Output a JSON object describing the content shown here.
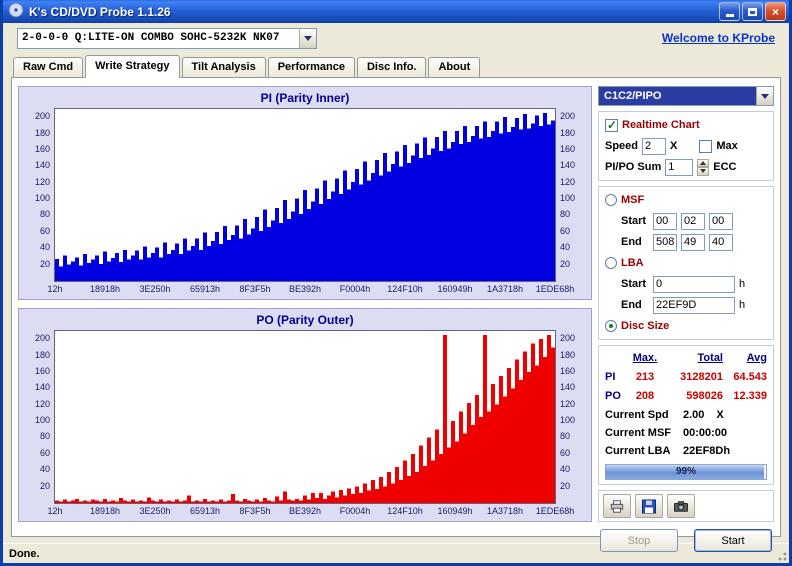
{
  "window": {
    "title": "K's CD/DVD Probe 1.1.26"
  },
  "toolbar": {
    "drive_selector": "2-0-0-0 Q:LITE-ON COMBO SOHC-5232K NK07",
    "welcome_link": "Welcome to KProbe"
  },
  "tabs": {
    "items": [
      "Raw Cmd",
      "Write Strategy",
      "Tilt Analysis",
      "Performance",
      "Disc Info.",
      "About"
    ],
    "active": "Write Strategy"
  },
  "side": {
    "mode_select": "C1C2/PIPO",
    "realtime_chart": {
      "label": "Realtime Chart",
      "checked": true
    },
    "speed": {
      "label": "Speed",
      "value": "2",
      "unit": "X"
    },
    "max": {
      "label": "Max",
      "checked": false
    },
    "pipo_sum": {
      "label": "PI/PO Sum",
      "value": "1",
      "unit": "ECC"
    },
    "msf": {
      "label": "MSF",
      "selected": false,
      "start_label": "Start",
      "start": [
        "00",
        "02",
        "00"
      ],
      "end_label": "End",
      "end": [
        "508",
        "49",
        "40"
      ]
    },
    "lba": {
      "label": "LBA",
      "selected": false,
      "start_label": "Start",
      "start": "0",
      "end_label": "End",
      "end": "22EF9D",
      "unit": "h"
    },
    "disc_size": {
      "label": "Disc Size",
      "selected": true
    },
    "stats": {
      "headers": [
        "Max.",
        "Total",
        "Avg"
      ],
      "rows": [
        {
          "name": "PI",
          "max": "213",
          "total": "3128201",
          "avg": "64.543"
        },
        {
          "name": "PO",
          "max": "208",
          "total": "598026",
          "avg": "12.339"
        }
      ],
      "current_spd_label": "Current Spd",
      "current_spd": "2.00",
      "current_spd_unit": "X",
      "current_msf_label": "Current MSF",
      "current_msf": "00:00:00",
      "current_lba_label": "Current LBA",
      "current_lba": "22EF8Dh"
    },
    "progress": {
      "percent": 99,
      "label": "99%"
    },
    "actions": {
      "stop": "Stop",
      "stop_enabled": false,
      "start": "Start",
      "start_enabled": true
    }
  },
  "statusbar": {
    "text": "Done."
  },
  "chart_data": [
    {
      "type": "bar",
      "title": "PI (Parity Inner)",
      "xlabel": "",
      "ylabel": "",
      "ylim": [
        0,
        210
      ],
      "y_ticks": [
        20,
        40,
        60,
        80,
        100,
        120,
        140,
        160,
        180,
        200
      ],
      "x_tick_labels": [
        "12h",
        "18918h",
        "3E250h",
        "65913h",
        "8F3F5h",
        "BE392h",
        "F0004h",
        "124F10h",
        "160949h",
        "1A3718h",
        "1EDE68h"
      ],
      "color": "#0000e0",
      "values": [
        27,
        18,
        31,
        20,
        24,
        29,
        19,
        33,
        22,
        26,
        31,
        21,
        36,
        24,
        28,
        34,
        23,
        38,
        26,
        31,
        37,
        26,
        42,
        29,
        34,
        41,
        29,
        47,
        33,
        38,
        46,
        33,
        52,
        37,
        43,
        52,
        38,
        59,
        43,
        49,
        60,
        45,
        67,
        50,
        56,
        68,
        52,
        76,
        57,
        64,
        78,
        61,
        87,
        66,
        74,
        89,
        71,
        99,
        76,
        85,
        101,
        82,
        111,
        88,
        97,
        113,
        94,
        123,
        100,
        109,
        125,
        106,
        135,
        112,
        121,
        137,
        118,
        146,
        123,
        132,
        148,
        129,
        156,
        134,
        143,
        158,
        140,
        166,
        144,
        153,
        168,
        150,
        175,
        154,
        162,
        176,
        159,
        183,
        162,
        170,
        183,
        167,
        189,
        170,
        177,
        189,
        174,
        195,
        176,
        183,
        195,
        180,
        200,
        182,
        188,
        199,
        185,
        204,
        186,
        192,
        202,
        189,
        205,
        191,
        196
      ]
    },
    {
      "type": "bar",
      "title": "PO (Parity Outer)",
      "xlabel": "",
      "ylabel": "",
      "ylim": [
        0,
        210
      ],
      "y_ticks": [
        20,
        40,
        60,
        80,
        100,
        120,
        140,
        160,
        180,
        200
      ],
      "x_tick_labels": [
        "12h",
        "18918h",
        "3E250h",
        "65913h",
        "8F3F5h",
        "BE392h",
        "F0004h",
        "124F10h",
        "160949h",
        "1A3718h",
        "1EDE68h"
      ],
      "color": "#ee0000",
      "values": [
        3,
        2,
        4,
        2,
        3,
        5,
        2,
        3,
        2,
        4,
        3,
        2,
        5,
        2,
        3,
        2,
        6,
        3,
        2,
        4,
        2,
        3,
        2,
        7,
        3,
        2,
        4,
        2,
        3,
        2,
        4,
        2,
        3,
        9,
        2,
        3,
        2,
        5,
        2,
        3,
        2,
        4,
        2,
        3,
        11,
        3,
        2,
        5,
        3,
        2,
        4,
        2,
        6,
        3,
        2,
        8,
        3,
        14,
        4,
        3,
        5,
        3,
        9,
        4,
        12,
        6,
        12,
        5,
        9,
        14,
        7,
        16,
        9,
        18,
        11,
        20,
        12,
        24,
        15,
        28,
        17,
        32,
        20,
        38,
        24,
        44,
        28,
        52,
        33,
        60,
        38,
        70,
        45,
        80,
        52,
        90,
        60,
        205,
        68,
        100,
        75,
        112,
        85,
        122,
        95,
        132,
        105,
        205,
        112,
        145,
        120,
        155,
        130,
        165,
        140,
        175,
        150,
        185,
        160,
        195,
        168,
        200,
        178,
        205,
        190
      ]
    }
  ]
}
